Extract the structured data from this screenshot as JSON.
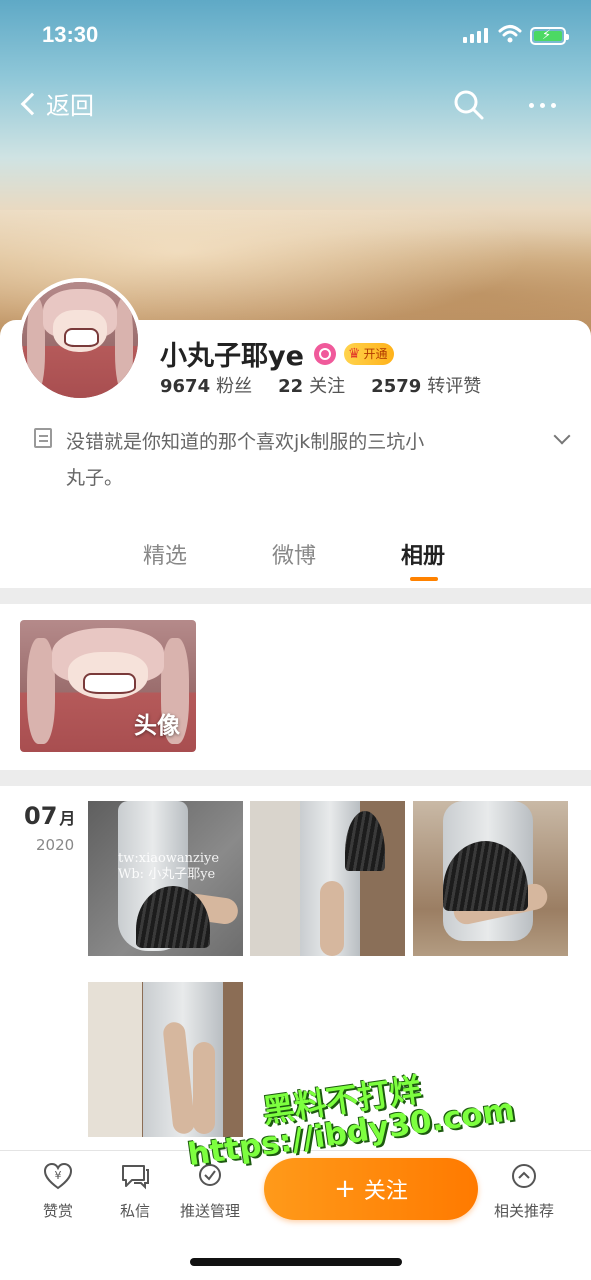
{
  "status_bar": {
    "time": "13:30"
  },
  "nav": {
    "back_label": "返回"
  },
  "profile": {
    "name": "小丸子耶ye",
    "vip_label": "开通",
    "stats": [
      {
        "num": "9674",
        "label": "粉丝"
      },
      {
        "num": "22",
        "label": "关注"
      },
      {
        "num": "2579",
        "label": "转评赞"
      }
    ],
    "bio_line1": "没错就是你知道的那个喜欢jk制服的三坑小",
    "bio_line2": "丸子。"
  },
  "tabs": [
    {
      "label": "精选",
      "active": false
    },
    {
      "label": "微博",
      "active": false
    },
    {
      "label": "相册",
      "active": true
    }
  ],
  "albums": [
    {
      "label": "头像"
    }
  ],
  "timeline": {
    "month": "07",
    "month_suffix": "月",
    "year": "2020",
    "watermark_line1": "tw:xiaowanziye",
    "watermark_line2": "Wb: 小丸子耶ye"
  },
  "bottom_bar": {
    "reward": "赞赏",
    "message": "私信",
    "push": "推送管理",
    "follow": "关注",
    "follow_plus": "+",
    "recommend": "相关推荐"
  },
  "overlay": {
    "line1": "黑料不打烊",
    "line2": "https://ibdy30.com"
  },
  "colors": {
    "accent": "#ff8200",
    "verify": "#f05a9b",
    "vip": "#ffb21a",
    "overlay_text": "#7dff3f"
  }
}
